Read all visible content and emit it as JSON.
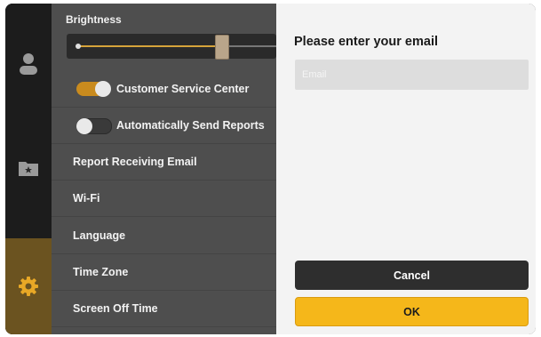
{
  "settings": {
    "brightness_label": "Brightness",
    "brightness_level_percent": 72,
    "rows": [
      {
        "label": "Customer Service Center",
        "toggle": "on"
      },
      {
        "label": "Automatically Send Reports",
        "toggle": "off"
      },
      {
        "label": "Report Receiving Email"
      },
      {
        "label": "Wi-Fi"
      },
      {
        "label": "Language"
      },
      {
        "label": "Time Zone"
      },
      {
        "label": "Screen Off Time"
      }
    ]
  },
  "sidebar": {
    "icons": [
      "user-icon",
      "folder-star-icon",
      "gear-icon"
    ],
    "active": "gear-icon"
  },
  "dialog": {
    "title": "Please enter your email",
    "email_placeholder": "Email",
    "email_value": "",
    "cancel_label": "Cancel",
    "ok_label": "OK"
  },
  "colors": {
    "accent": "#f5b71a",
    "toggle_on": "#c98b1e",
    "cancel_bg": "#2e2e2e"
  }
}
